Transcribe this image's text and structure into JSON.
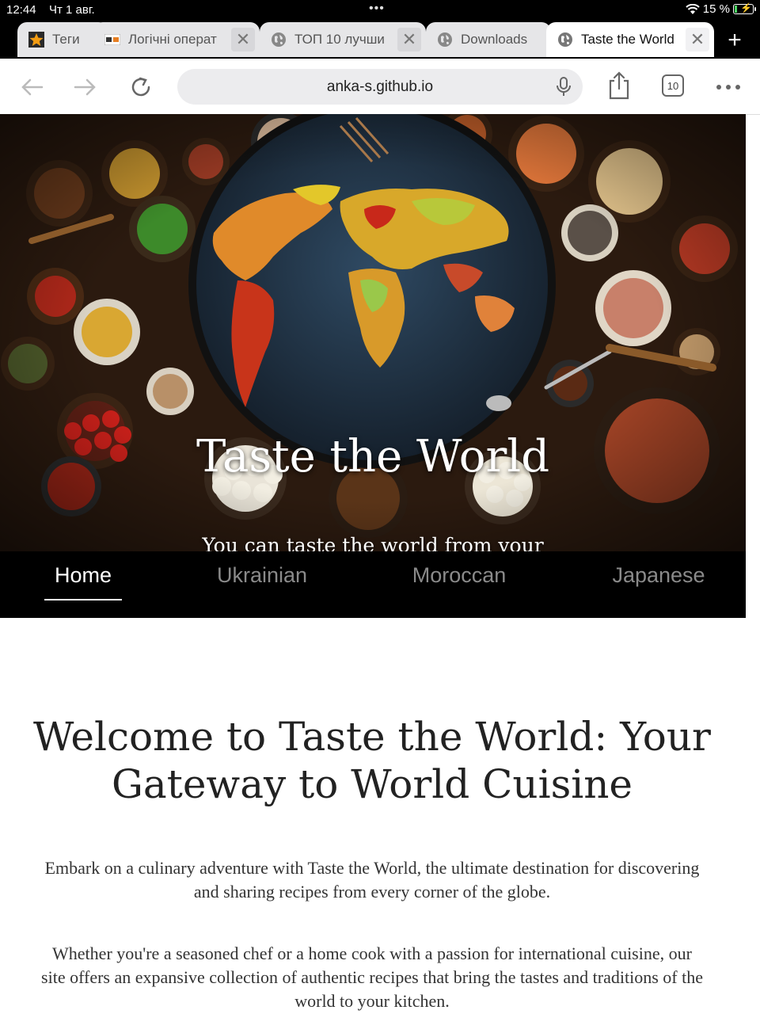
{
  "status": {
    "time": "12:44",
    "date": "Чт 1 авг.",
    "battery": "15 %",
    "battery_level": 0.15
  },
  "tabs": [
    {
      "title": "Теги",
      "favicon": "star-icon"
    },
    {
      "title": "Логічні операт",
      "favicon": "site-logo-icon"
    },
    {
      "title": "ТОП 10 лучши",
      "favicon": "globe-icon"
    },
    {
      "title": "Downloads",
      "favicon": "globe-icon"
    },
    {
      "title": "Taste the World",
      "favicon": "globe-icon",
      "active": true
    }
  ],
  "toolbar": {
    "url": "anka-s.github.io",
    "tab_count": "10",
    "icons": [
      "back-arrow-icon",
      "forward-arrow-icon",
      "reload-icon",
      "microphone-icon",
      "share-icon",
      "tabs-icon",
      "more-icon",
      "new-tab-icon"
    ]
  },
  "hero": {
    "title": "Taste the World",
    "subtitle": "You can taste the world from your kitchen"
  },
  "nav": [
    {
      "label": "Home",
      "active": true
    },
    {
      "label": "Ukrainian"
    },
    {
      "label": "Moroccan"
    },
    {
      "label": "Japanese"
    }
  ],
  "content": {
    "heading": "Welcome to Taste the World: Your Gateway to World Cuisine",
    "paragraph1": "Embark on a culinary adventure with Taste the World, the ultimate destination for discovering and sharing recipes from every corner of the globe.",
    "paragraph2": "Whether you're a seasoned chef or a home cook with a passion for international cuisine, our site offers an expansive collection of authentic recipes that bring the tastes and traditions of the world to your kitchen."
  },
  "colors": {
    "nav_bg": "#000000",
    "nav_active": "#ffffff",
    "nav_inactive": "#8a8a8a",
    "heading": "#222222"
  }
}
